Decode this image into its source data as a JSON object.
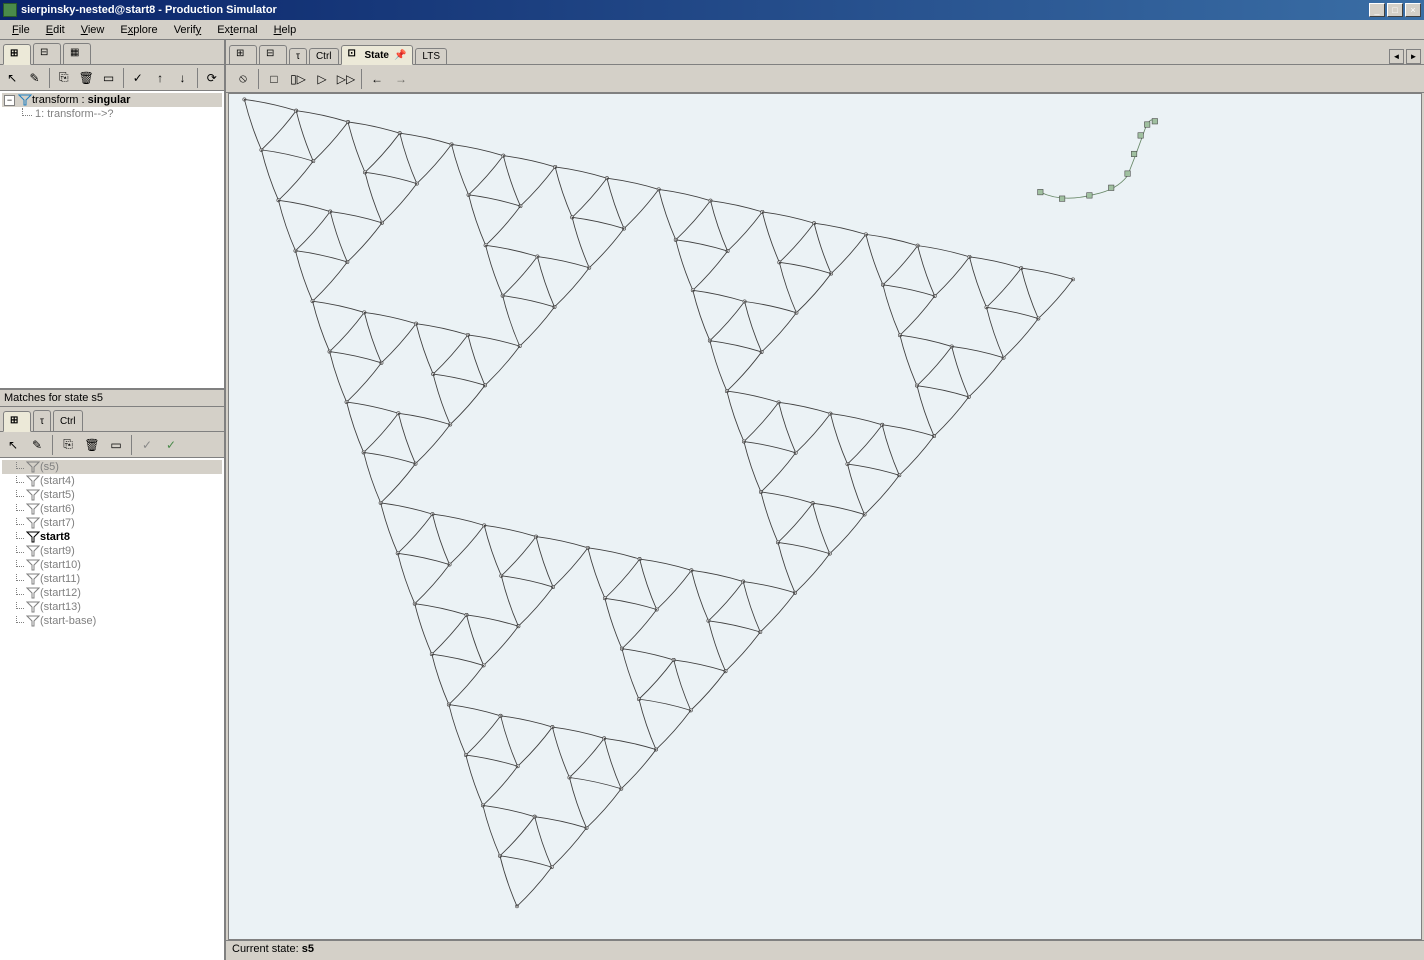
{
  "window": {
    "title": "sierpinsky-nested@start8 - Production Simulator"
  },
  "menu": {
    "file": "File",
    "edit": "Edit",
    "view": "View",
    "explore": "Explore",
    "verify": "Verify",
    "external": "External",
    "help": "Help"
  },
  "left_top": {
    "tree": {
      "root_label": "transform : ",
      "root_bold": "singular",
      "child_label": "1: transform-->?"
    }
  },
  "matches_header": "Matches for state s5",
  "left_bottom": {
    "items": [
      {
        "label": "(s5)",
        "selected": true,
        "gray": true
      },
      {
        "label": "(start4)",
        "gray": true
      },
      {
        "label": "(start5)",
        "gray": true
      },
      {
        "label": "(start6)",
        "gray": true
      },
      {
        "label": "(start7)",
        "gray": true
      },
      {
        "label": "start8",
        "bold": true
      },
      {
        "label": "(start9)",
        "gray": true
      },
      {
        "label": "(start10)",
        "gray": true
      },
      {
        "label": "(start11)",
        "gray": true
      },
      {
        "label": "(start12)",
        "gray": true
      },
      {
        "label": "(start13)",
        "gray": true
      },
      {
        "label": "(start-base)",
        "gray": true
      }
    ]
  },
  "right_tabs": {
    "state": "State",
    "lts": "LTS"
  },
  "status": {
    "prefix": "Current state: ",
    "value": "s5"
  },
  "left_small_tabs": {
    "tau": "τ",
    "ctrl": "Ctrl"
  }
}
